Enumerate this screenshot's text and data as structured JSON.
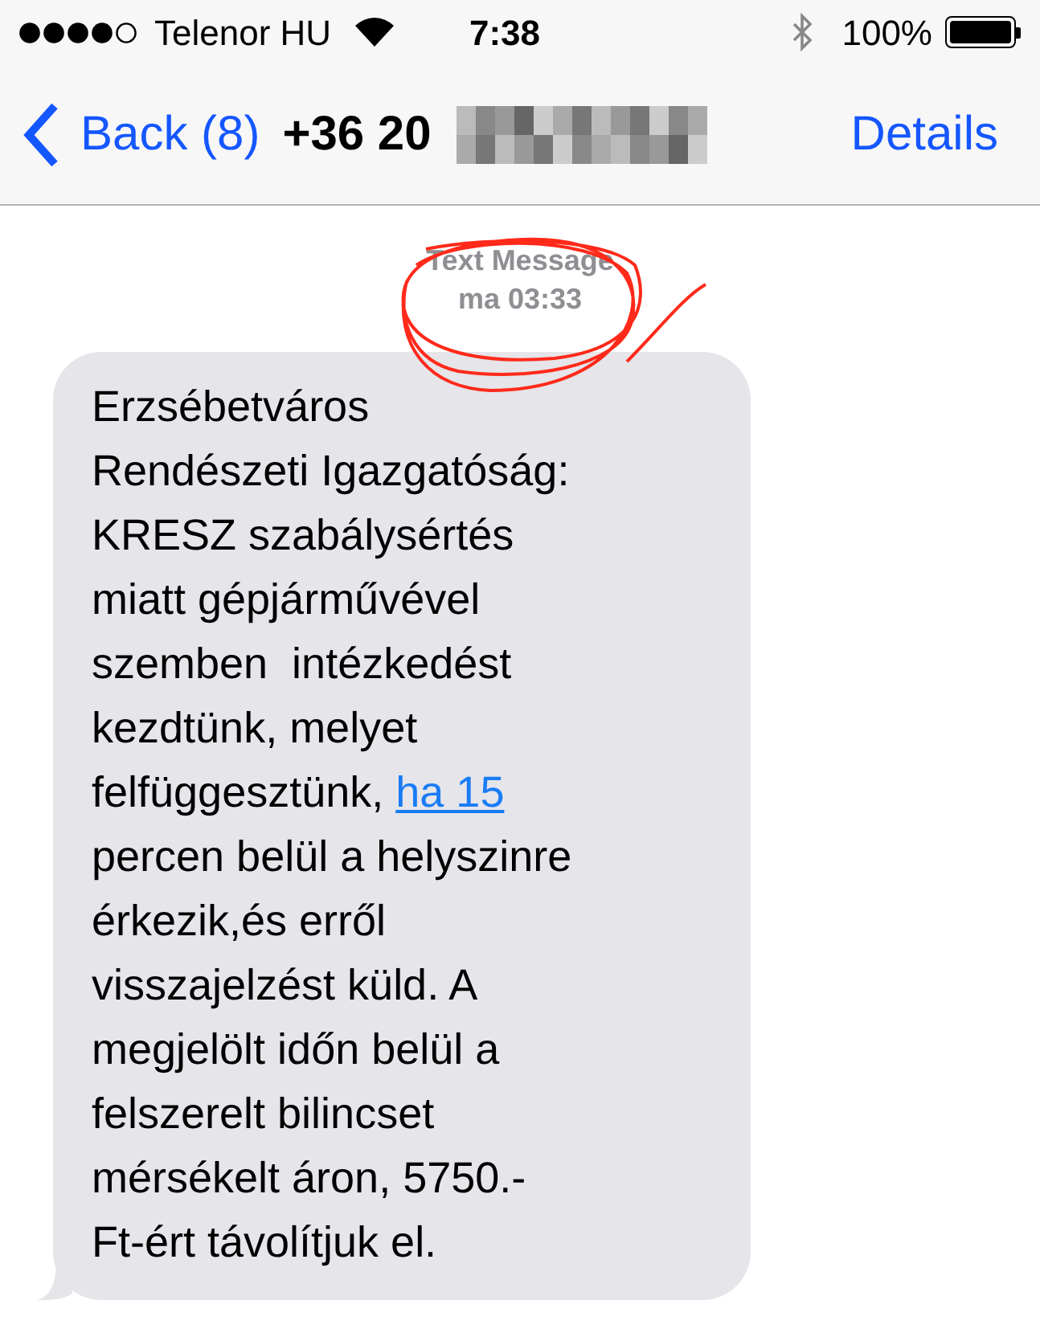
{
  "status_bar": {
    "carrier": "Telenor HU",
    "time": "7:38",
    "battery": "100%"
  },
  "nav": {
    "back": "Back (8)",
    "title": "+36 20",
    "action": "Details"
  },
  "timestamp": {
    "label": "Text Message",
    "time": "ma 03:33"
  },
  "message": {
    "before_lines": [
      "Erzsébetváros",
      "Rendészeti Igazgatóság:",
      "KRESZ szabálysértés",
      "miatt gépjárművével",
      "szemben  intézkedést",
      "kezdtünk, melyet",
      "felfüggesztünk,"
    ],
    "link": "ha 15",
    "after_lines": [
      "percen belül a helyszinre",
      "érkezik,és erről",
      "visszajelzést küld. A",
      "megjelölt időn belül a",
      "felszerelt bilincset",
      "mérsékelt áron, 5750.-",
      "Ft-ért távolítjuk el."
    ]
  }
}
